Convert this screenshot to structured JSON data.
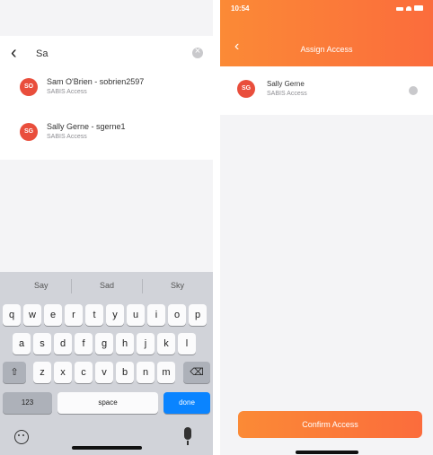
{
  "left_screen": {
    "search": {
      "value": "Sa",
      "placeholder": ""
    },
    "results": [
      {
        "initials": "SO",
        "title": "Sam O'Brien - sobrien2597",
        "subtitle": "SABIS Access"
      },
      {
        "initials": "SG",
        "title": "Sally Gerne - sgerne1",
        "subtitle": "SABIS Access"
      }
    ],
    "keyboard": {
      "suggestions": [
        "Say",
        "Sad",
        "Sky"
      ],
      "row1": [
        "q",
        "w",
        "e",
        "r",
        "t",
        "y",
        "u",
        "i",
        "o",
        "p"
      ],
      "row2": [
        "a",
        "s",
        "d",
        "f",
        "g",
        "h",
        "j",
        "k",
        "l"
      ],
      "row3": [
        "z",
        "x",
        "c",
        "v",
        "b",
        "n",
        "m"
      ],
      "shift_glyph": "⇧",
      "delete_glyph": "⌫",
      "numbers_label": "123",
      "space_label": "space",
      "done_label": "done"
    }
  },
  "right_screen": {
    "status_time": "10:54",
    "header_title": "Assign Access",
    "back_glyph": "‹",
    "assigned": {
      "initials": "SG",
      "title": "Sally Gerne",
      "subtitle": "SABIS Access"
    },
    "confirm_label": "Confirm Access"
  },
  "colors": {
    "accent": "#fb7b38",
    "avatar": "#e94e3c",
    "keyboard_done": "#0a84ff"
  }
}
